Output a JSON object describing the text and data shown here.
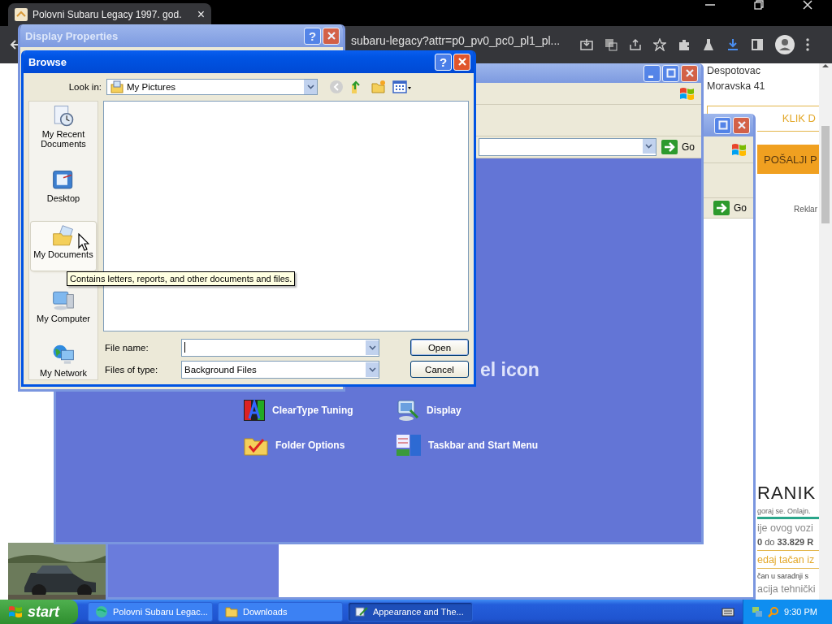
{
  "browser": {
    "tab": {
      "title": "Polovni Subaru Legacy 1997. god.",
      "close": "×"
    },
    "url": "subaru-legacy?attr=p0_pv0_pc0_pl1_pl..."
  },
  "web_page": {
    "address_lines": [
      "Despotovac",
      "Moravska 41"
    ],
    "buttons": [
      {
        "label": "KLIK D",
        "kind": "outline"
      },
      {
        "label": "POŠALJI P",
        "kind": "filled"
      }
    ],
    "ad_label": "Reklar",
    "brand": "RANIK",
    "tagline": "goraj se. Onlajn.",
    "lines": [
      {
        "text": "ije ovog vozi",
        "kind": "muted"
      },
      {
        "text": "**0** do **33.829 R**",
        "kind": "price"
      },
      {
        "text": "edaj tačan iz",
        "kind": "link"
      },
      {
        "text": "čan u saradnji s",
        "kind": "small"
      },
      {
        "text": "acija tehnički",
        "kind": "muted"
      }
    ]
  },
  "control_panel_back": {
    "go": "Go"
  },
  "control_panel_front": {
    "go": "Go",
    "heading": "el icon",
    "tasks": [
      {
        "label": "ClearType Tuning",
        "kind": "cleartype"
      },
      {
        "label": "Display",
        "kind": "display"
      },
      {
        "label": "Folder Options",
        "kind": "folder"
      },
      {
        "label": "Taskbar and Start Menu",
        "kind": "taskbar"
      }
    ]
  },
  "display_properties": {
    "title": "Display Properties",
    "help": "?"
  },
  "browse_dialog": {
    "title": "Browse",
    "help": "?",
    "look_in_label": "Look in:",
    "look_in": "My Pictures",
    "places": [
      {
        "label": "My Recent Documents",
        "kind": "recent",
        "selected": false
      },
      {
        "label": "Desktop",
        "kind": "desktop",
        "selected": false
      },
      {
        "label": "My Documents",
        "kind": "documents",
        "selected": true
      },
      {
        "label": "My Computer",
        "kind": "computer",
        "selected": false
      },
      {
        "label": "My Network",
        "kind": "network",
        "selected": false
      }
    ],
    "file_name_label": "File name:",
    "files_of_type_label": "Files of type:",
    "files_of_type": "Background Files",
    "buttons": [
      {
        "label": "Open",
        "default": true
      },
      {
        "label": "Cancel",
        "default": false
      }
    ],
    "tooltip": "Contains letters, reports, and other documents and files."
  },
  "taskbar": {
    "start": "start",
    "items": [
      {
        "label": "Polovni Subaru Legac...",
        "kind": "browser",
        "selected": false
      },
      {
        "label": "Downloads",
        "kind": "folder",
        "selected": false
      },
      {
        "label": "Appearance and The...",
        "kind": "control-panel",
        "selected": true
      }
    ],
    "clock": "9:30 PM"
  }
}
